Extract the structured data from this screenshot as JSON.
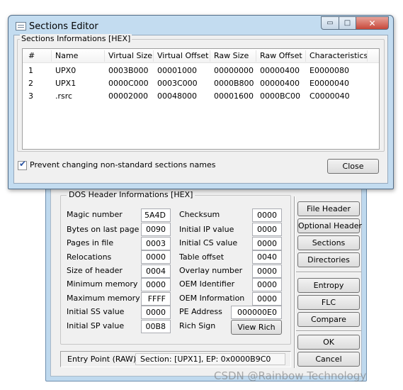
{
  "sections_editor": {
    "title": "Sections Editor",
    "caption": {
      "minimize": "▭",
      "maximize": "□",
      "close": "✕"
    },
    "group_title": "Sections Informations [HEX]",
    "columns": [
      "#",
      "Name",
      "Virtual Size",
      "Virtual Offset",
      "Raw Size",
      "Raw Offset",
      "Characteristics"
    ],
    "rows": [
      [
        "1",
        "UPX0",
        "0003B000",
        "00001000",
        "00000000",
        "00000400",
        "E0000080"
      ],
      [
        "2",
        "UPX1",
        "0000C000",
        "0003C000",
        "0000B800",
        "00000400",
        "E0000040"
      ],
      [
        "3",
        ".rsrc",
        "00002000",
        "00048000",
        "00001600",
        "0000BC00",
        "C0000040"
      ]
    ],
    "checkbox_label": "Prevent changing non-standard sections names",
    "checkbox_checked": true,
    "close_button": "Close"
  },
  "dos_header": {
    "group_title": "DOS Header Informations [HEX]",
    "left_fields": [
      {
        "label": "Magic number",
        "value": "5A4D"
      },
      {
        "label": "Bytes on last page",
        "value": "0090"
      },
      {
        "label": "Pages in file",
        "value": "0003"
      },
      {
        "label": "Relocations",
        "value": "0000"
      },
      {
        "label": "Size of header",
        "value": "0004"
      },
      {
        "label": "Minimum memory",
        "value": "0000"
      },
      {
        "label": "Maximum memory",
        "value": "FFFF"
      },
      {
        "label": "Initial SS value",
        "value": "0000"
      },
      {
        "label": "Initial SP value",
        "value": "00B8"
      }
    ],
    "right_fields": [
      {
        "label": "Checksum",
        "value": "0000"
      },
      {
        "label": "Initial IP value",
        "value": "0000"
      },
      {
        "label": "Initial CS value",
        "value": "0000"
      },
      {
        "label": "Table offset",
        "value": "0040"
      },
      {
        "label": "Overlay number",
        "value": "0000"
      },
      {
        "label": "OEM Identifier",
        "value": "0000"
      },
      {
        "label": "OEM Information",
        "value": "0000"
      }
    ],
    "pe_address": {
      "label": "PE Address",
      "value": "000000E0"
    },
    "rich_sign": {
      "label": "Rich Sign",
      "button": "View Rich"
    },
    "entry_point": {
      "label": "Entry Point (RAW):",
      "value": "Section: [UPX1], EP: 0x0000B9C0"
    }
  },
  "side_buttons": {
    "file_header": "File Header",
    "optional_header": "Optional Header",
    "sections": "Sections",
    "directories": "Directories",
    "entropy": "Entropy",
    "flc": "FLC",
    "compare": "Compare",
    "ok": "OK",
    "cancel": "Cancel"
  },
  "watermark": "CSDN @Rainbow Technology"
}
